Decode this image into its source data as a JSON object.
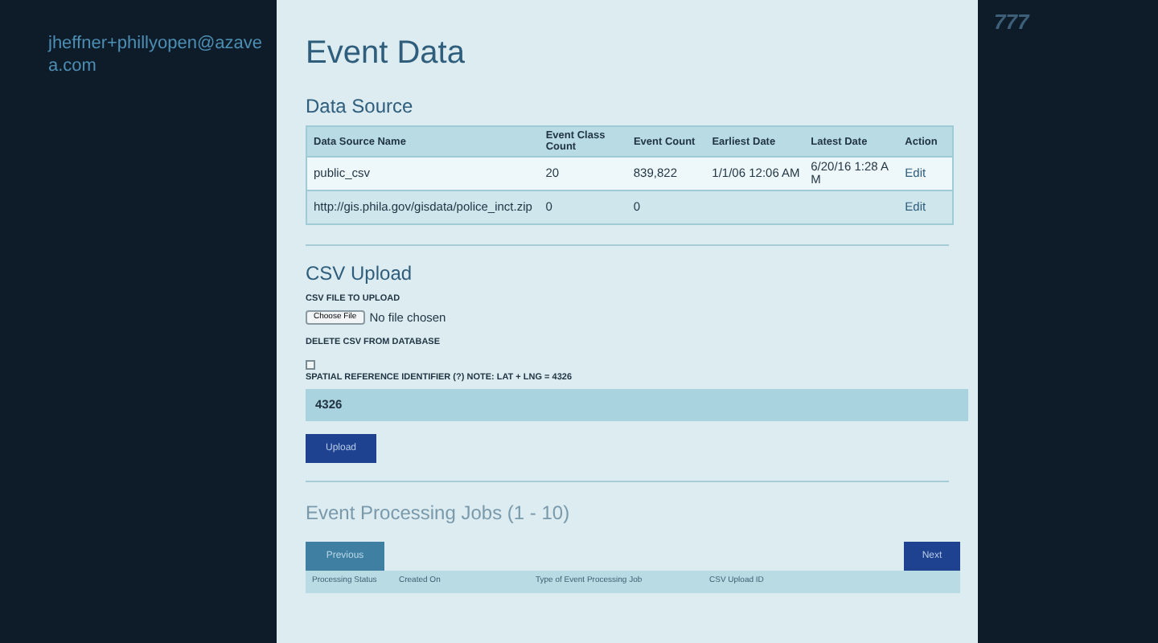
{
  "sidebar": {
    "user_email": "jheffner+phillyopen@azavea.com"
  },
  "corner_text": "777",
  "page": {
    "title": "Event Data"
  },
  "data_source": {
    "heading": "Data Source",
    "columns": [
      "Data Source Name",
      "Event Class Count",
      "Event Count",
      "Earliest Date",
      "Latest Date",
      "Action"
    ],
    "rows": [
      {
        "cells": [
          "public_csv",
          "20",
          "839,822",
          "1/1/06 12:06 AM",
          "6/20/16 1:28 AM"
        ],
        "action": "Edit"
      },
      {
        "cells": [
          "http://gis.phila.gov/gisdata/police_inct.zip",
          "0",
          "0",
          "",
          ""
        ],
        "action": "Edit"
      }
    ]
  },
  "csv_upload": {
    "heading": "CSV Upload",
    "file_label": "CSV FILE TO UPLOAD",
    "file_button": "Choose File",
    "file_status": "No file chosen",
    "delete_label": "DELETE CSV FROM DATABASE",
    "delete_checked": false,
    "srid_label": "SPATIAL REFERENCE IDENTIFIER (?) NOTE: LAT + LNG = 4326",
    "srid_value": "4326",
    "submit": "Upload"
  },
  "jobs": {
    "heading": "Event Processing Jobs (1 - 10)",
    "previous": "Previous",
    "next": "Next",
    "columns": [
      "Processing Status",
      "Created On",
      "Type of Event Processing Job",
      "CSV Upload ID"
    ]
  }
}
